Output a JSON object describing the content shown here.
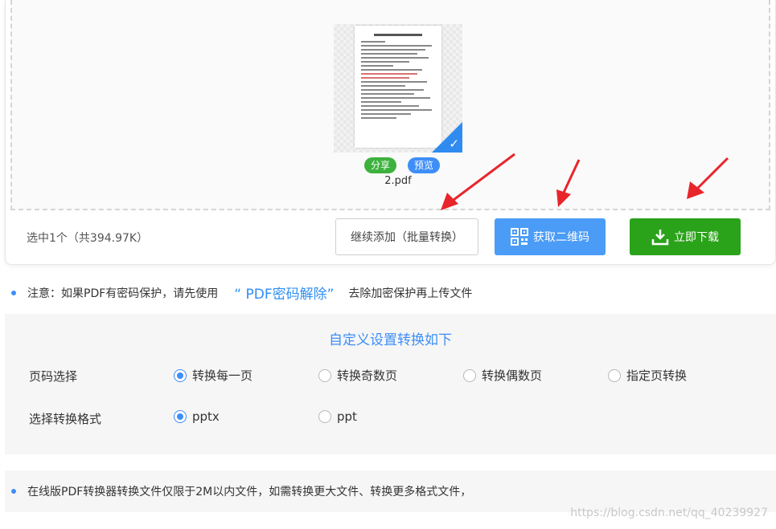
{
  "file": {
    "name": "2.pdf",
    "share_label": "分享",
    "preview_label": "预览"
  },
  "toolbar": {
    "selection_text": "选中1个（共394.97K）",
    "add_label": "继续添加（批量转换）",
    "qr_label": "获取二维码",
    "download_label": "立即下载"
  },
  "notice": {
    "prefix": "注意：如果PDF有密码保护，请先使用",
    "link": "“ PDF密码解除”",
    "suffix": "去除加密保护再上传文件"
  },
  "settings": {
    "title": "自定义设置转换如下",
    "page_label": "页码选择",
    "page_options": [
      "转换每一页",
      "转换奇数页",
      "转换偶数页",
      "指定页转换"
    ],
    "page_selected": "转换每一页",
    "format_label": "选择转换格式",
    "format_options": [
      "pptx",
      "ppt"
    ],
    "format_selected": "pptx"
  },
  "info": {
    "text": "在线版PDF转换器转换文件仅限于2M以内文件，如需转换更大文件、转换更多格式文件，"
  },
  "watermark": "https://blog.csdn.net/qq_40239927",
  "colors": {
    "primary": "#3e8ef7",
    "download": "#2aa21a",
    "arrow": "#e8252b"
  }
}
